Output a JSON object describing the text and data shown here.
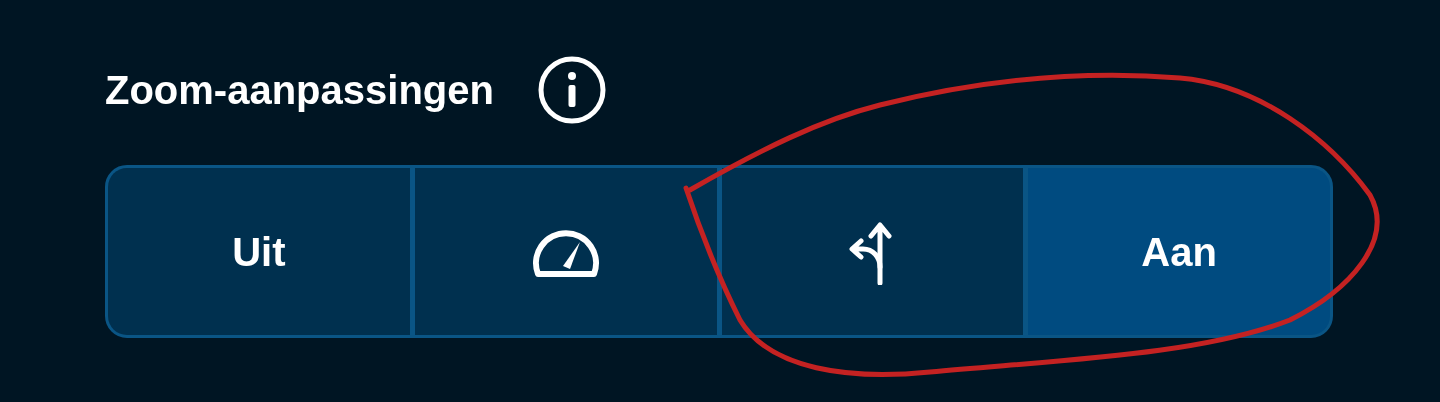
{
  "section": {
    "title": "Zoom-aanpassingen"
  },
  "segments": [
    {
      "kind": "label",
      "label": "Uit",
      "selected": false
    },
    {
      "kind": "gauge",
      "selected": false
    },
    {
      "kind": "turn",
      "selected": false
    },
    {
      "kind": "label",
      "label": "Aan",
      "selected": true
    }
  ]
}
